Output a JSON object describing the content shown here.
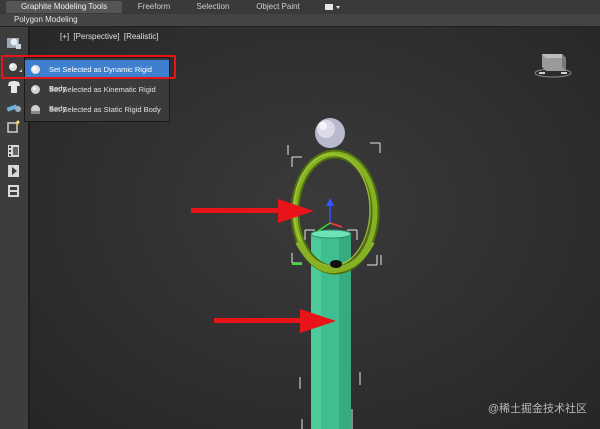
{
  "ribbon": {
    "tabs": [
      {
        "label": "Graphite Modeling Tools",
        "active": true
      },
      {
        "label": "Freeform",
        "active": false
      },
      {
        "label": "Selection",
        "active": false
      },
      {
        "label": "Object Paint",
        "active": false
      }
    ],
    "sub_label": "Polygon Modeling"
  },
  "toolbar": {
    "buttons": [
      {
        "icon": "world-icon"
      },
      {
        "icon": "rigid-body-icon"
      },
      {
        "icon": "cloth-icon"
      },
      {
        "icon": "constraint-icon"
      },
      {
        "icon": "fracture-icon"
      },
      {
        "icon": "film-icon"
      },
      {
        "icon": "play-icon"
      },
      {
        "icon": "bake-icon"
      }
    ]
  },
  "viewport": {
    "label_parts": [
      "[+]",
      "[Perspective]",
      "[Realistic]"
    ]
  },
  "flyout": {
    "items": [
      {
        "label": "Set Selected as Dynamic Rigid Body",
        "selected": true
      },
      {
        "label": "Set Selected as Kinematic Rigid Body",
        "selected": false
      },
      {
        "label": "Set Selected as Static Rigid Body",
        "selected": false
      }
    ]
  },
  "watermark": "@稀土掘金技术社区",
  "colors": {
    "accent_selected": "#3f7fd0",
    "annotation_red": "#e8141a",
    "cylinder": "#3fbf8f",
    "torus": "#7aa51e",
    "sphere": "#cfcfe0"
  }
}
